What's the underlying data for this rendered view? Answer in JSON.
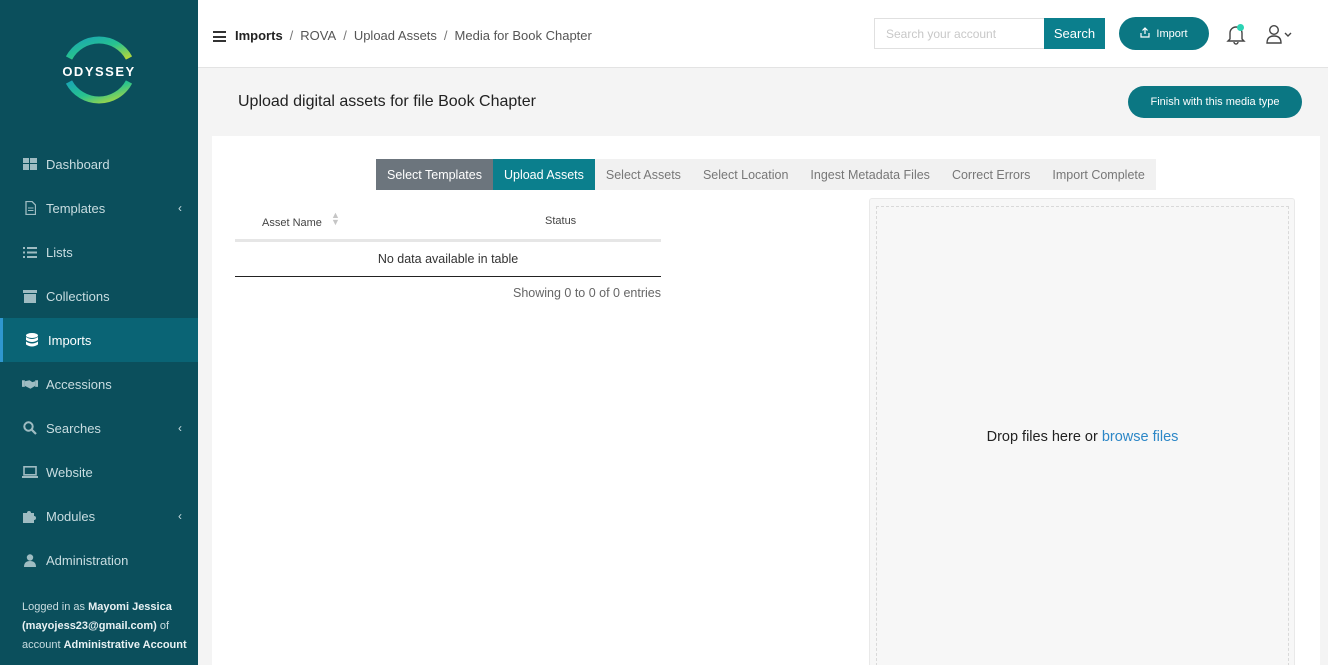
{
  "brand": {
    "name": "ODYSSEY"
  },
  "sidebar": {
    "items": [
      {
        "label": "Dashboard",
        "icon": "dashboard-icon",
        "chevron": false,
        "active": false
      },
      {
        "label": "Templates",
        "icon": "file-icon",
        "chevron": true,
        "active": false
      },
      {
        "label": "Lists",
        "icon": "list-icon",
        "chevron": false,
        "active": false
      },
      {
        "label": "Collections",
        "icon": "archive-icon",
        "chevron": false,
        "active": false
      },
      {
        "label": "Imports",
        "icon": "database-icon",
        "chevron": false,
        "active": true
      },
      {
        "label": "Accessions",
        "icon": "handshake-icon",
        "chevron": false,
        "active": false
      },
      {
        "label": "Searches",
        "icon": "search-icon",
        "chevron": true,
        "active": false
      },
      {
        "label": "Website",
        "icon": "laptop-icon",
        "chevron": false,
        "active": false
      },
      {
        "label": "Modules",
        "icon": "puzzle-icon",
        "chevron": true,
        "active": false
      },
      {
        "label": "Administration",
        "icon": "user-icon",
        "chevron": false,
        "active": false
      }
    ],
    "logged_in": {
      "prefix": "Logged in as",
      "user_name": "Mayomi Jessica",
      "email": "(mayojess23@gmail.com)",
      "middle": "of account",
      "account": "Administrative Account"
    }
  },
  "topbar": {
    "breadcrumb": [
      "Imports",
      "ROVA",
      "Upload Assets",
      "Media for Book Chapter"
    ],
    "search_placeholder": "Search your account",
    "search_label": "Search",
    "import_label": "Import"
  },
  "page": {
    "title": "Upload digital assets for file Book Chapter",
    "finish_label": "Finish with this media type"
  },
  "steps": [
    {
      "label": "Select Templates",
      "state": "done"
    },
    {
      "label": "Upload Assets",
      "state": "current"
    },
    {
      "label": "Select Assets",
      "state": "pending"
    },
    {
      "label": "Select Location",
      "state": "pending"
    },
    {
      "label": "Ingest Metadata Files",
      "state": "pending"
    },
    {
      "label": "Correct Errors",
      "state": "pending"
    },
    {
      "label": "Import Complete",
      "state": "pending"
    }
  ],
  "table": {
    "columns": [
      "Asset Name",
      "Status"
    ],
    "empty_text": "No data available in table",
    "info": "Showing 0 to 0 of 0 entries"
  },
  "dropzone": {
    "text": "Drop files here or",
    "link": "browse files"
  },
  "colors": {
    "sidebar_bg": "#0b4f5c",
    "accent": "#0b7f8d",
    "link": "#2c87c7"
  }
}
